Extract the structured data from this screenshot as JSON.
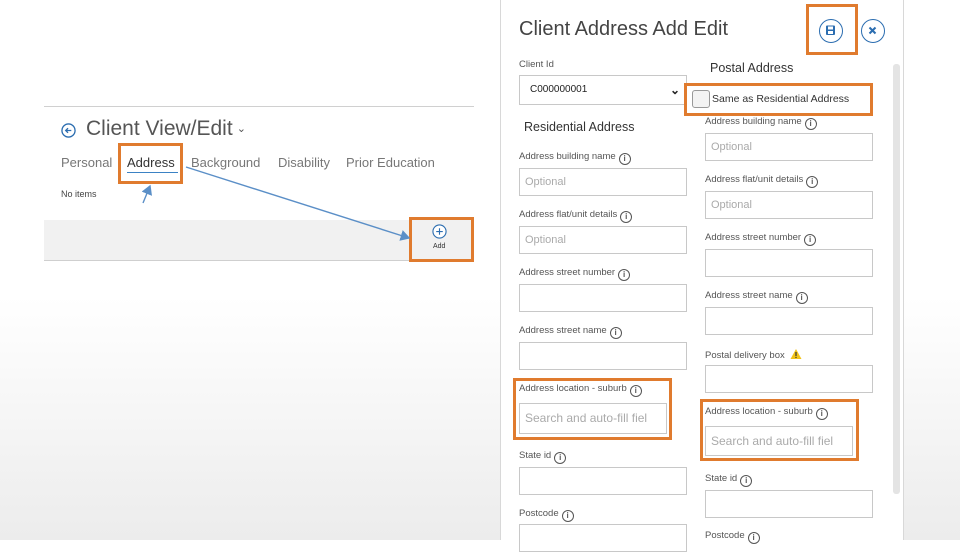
{
  "left": {
    "title": "Client View/Edit",
    "tabs": [
      "Personal",
      "Address",
      "Background",
      "Disability",
      "Prior Education"
    ],
    "no_items": "No items",
    "add_label": "Add"
  },
  "form": {
    "title": "Client Address Add Edit",
    "client_id_label": "Client Id",
    "client_id_value": "C000000001",
    "residential_title": "Residential Address",
    "postal_title": "Postal Address",
    "same_as_label": "Same as Residential Address",
    "residential": [
      {
        "label": "Address building name",
        "placeholder": "Optional"
      },
      {
        "label": "Address flat/unit details",
        "placeholder": "Optional"
      },
      {
        "label": "Address street number",
        "placeholder": ""
      },
      {
        "label": "Address street name",
        "placeholder": ""
      },
      {
        "label": "Address location - suburb",
        "placeholder": "Search and auto-fill fiel"
      },
      {
        "label": "State id",
        "placeholder": ""
      },
      {
        "label": "Postcode",
        "placeholder": ""
      }
    ],
    "postal": [
      {
        "label": "Address building name",
        "placeholder": "Optional"
      },
      {
        "label": "Address flat/unit details",
        "placeholder": "Optional"
      },
      {
        "label": "Address street number",
        "placeholder": ""
      },
      {
        "label": "Address street name",
        "placeholder": ""
      },
      {
        "label": "Postal delivery box",
        "placeholder": ""
      },
      {
        "label": "Address location - suburb",
        "placeholder": "Search and auto-fill fiel"
      },
      {
        "label": "State id",
        "placeholder": ""
      },
      {
        "label": "Postcode",
        "placeholder": ""
      }
    ]
  },
  "colors": {
    "highlight": "#e07b2e",
    "accent": "#2b6db0",
    "arrow": "#5b8fc7"
  },
  "icons": [
    "back-arrow-icon",
    "chevron-down-icon",
    "add-circle-icon",
    "save-icon",
    "close-icon",
    "info-icon",
    "warning-icon"
  ]
}
